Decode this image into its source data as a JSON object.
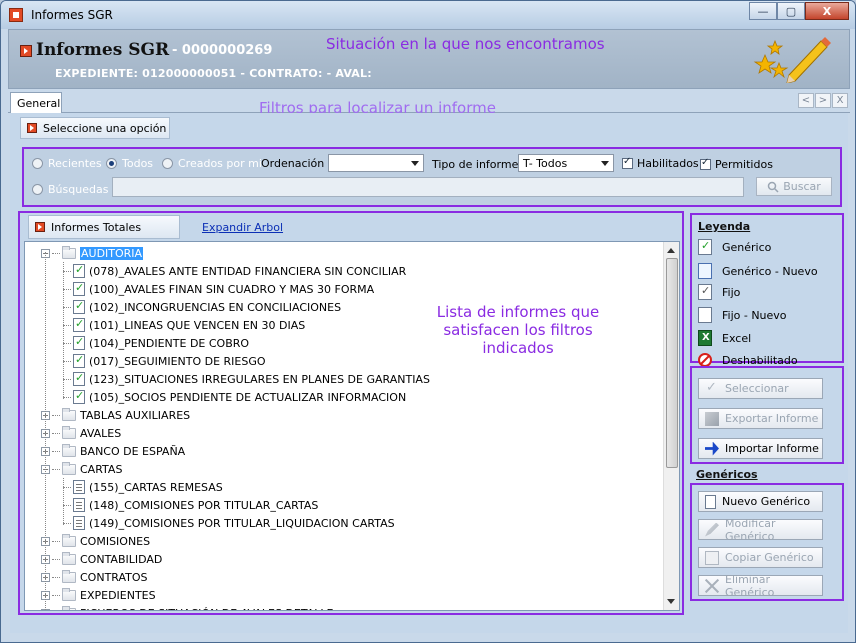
{
  "window": {
    "title": "Informes SGR",
    "controls": {
      "minimize": "—",
      "maximize": "▢",
      "close": "X"
    }
  },
  "header": {
    "title": "Informes SGR",
    "code": "- 0000000269",
    "subtitle": "EXPEDIENTE: 012000000051 - CONTRATO:  - AVAL:"
  },
  "annotations": {
    "situation": "Situación en la que nos encontramos",
    "filters": "Filtros para localizar un informe",
    "list": "Lista de informes que satisfacen los filtros indicados"
  },
  "tabs": [
    {
      "label": "General"
    }
  ],
  "tab_nav": {
    "prev": "<",
    "next": ">",
    "close": "X"
  },
  "options": {
    "label": "Seleccione una opción"
  },
  "filters": {
    "radio_recientes": "Recientes",
    "radio_todos": "Todos",
    "radio_creados": "Creados por mi",
    "radio_busquedas": "Búsquedas",
    "ordenacion_label": "Ordenación",
    "ordenacion_value": "",
    "tipo_label": "Tipo de informe",
    "tipo_value": "T- Todos",
    "habilitados": "Habilitados",
    "permitidos": "Permitidos",
    "search_value": "",
    "search_button": "Buscar",
    "search_icon": "magnifier-icon"
  },
  "tree": {
    "header": "Informes Totales",
    "expand_link": "Expandir Arbol",
    "items": [
      {
        "label": "AUDITORIA",
        "level": 0,
        "toggle": "−",
        "selected": true
      },
      {
        "label": "(078)_AVALES ANTE ENTIDAD FINANCIERA SIN CONCILIAR",
        "level": 1,
        "icon": "generic"
      },
      {
        "label": "(100)_AVALES FINAN SIN CUADRO Y MAS 30 FORMA",
        "level": 1,
        "icon": "generic"
      },
      {
        "label": "(102)_INCONGRUENCIAS EN CONCILIACIONES",
        "level": 1,
        "icon": "generic"
      },
      {
        "label": "(101)_LINEAS QUE VENCEN EN 30 DIAS",
        "level": 1,
        "icon": "generic"
      },
      {
        "label": "(104)_PENDIENTE DE COBRO",
        "level": 1,
        "icon": "generic"
      },
      {
        "label": "(017)_SEGUIMIENTO DE RIESGO",
        "level": 1,
        "icon": "generic"
      },
      {
        "label": "(123)_SITUACIONES IRREGULARES EN PLANES DE GARANTIAS",
        "level": 1,
        "icon": "generic"
      },
      {
        "label": "(105)_SOCIOS PENDIENTE DE ACTUALIZAR INFORMACION",
        "level": 1,
        "icon": "generic"
      },
      {
        "label": "TABLAS AUXILIARES",
        "level": 0,
        "toggle": "+"
      },
      {
        "label": "AVALES",
        "level": 0,
        "toggle": "+"
      },
      {
        "label": "BANCO DE ESPAÑA",
        "level": 0,
        "toggle": "+"
      },
      {
        "label": "CARTAS",
        "level": 0,
        "toggle": "−"
      },
      {
        "label": "(155)_CARTAS REMESAS",
        "level": 1,
        "icon": "fixed"
      },
      {
        "label": "(148)_COMISIONES POR TITULAR_CARTAS",
        "level": 1,
        "icon": "fixed"
      },
      {
        "label": "(149)_COMISIONES POR TITULAR_LIQUIDACION CARTAS",
        "level": 1,
        "icon": "fixed"
      },
      {
        "label": "COMISIONES",
        "level": 0,
        "toggle": "+"
      },
      {
        "label": "CONTABILIDAD",
        "level": 0,
        "toggle": "+"
      },
      {
        "label": "CONTRATOS",
        "level": 0,
        "toggle": "+"
      },
      {
        "label": "EXPEDIENTES",
        "level": 0,
        "toggle": "+"
      },
      {
        "label": "FICHEROS DE SITUACIÓN DE AVALES DETALLE",
        "level": 0,
        "toggle": "+"
      }
    ]
  },
  "legend": {
    "title": "Leyenda",
    "items": [
      {
        "label": "Genérico",
        "icon": "generic"
      },
      {
        "label": "Genérico - Nuevo",
        "icon": "generic-new"
      },
      {
        "label": "Fijo",
        "icon": "fixed"
      },
      {
        "label": "Fijo - Nuevo",
        "icon": "fixed-new"
      },
      {
        "label": "Excel",
        "icon": "excel"
      },
      {
        "label": "Deshabilitado",
        "icon": "disabled"
      }
    ]
  },
  "actions": {
    "select": "Seleccionar",
    "export": "Exportar Informe",
    "import": "Importar Informe"
  },
  "genericos": {
    "title": "Genéricos",
    "new": "Nuevo Genérico",
    "edit": "Modificar Genérico",
    "copy": "Copiar Genérico",
    "delete": "Eliminar Genérico"
  },
  "colors": {
    "annotation": "#8a2be2",
    "selection": "#3399ff",
    "link": "#0b2fb5"
  }
}
